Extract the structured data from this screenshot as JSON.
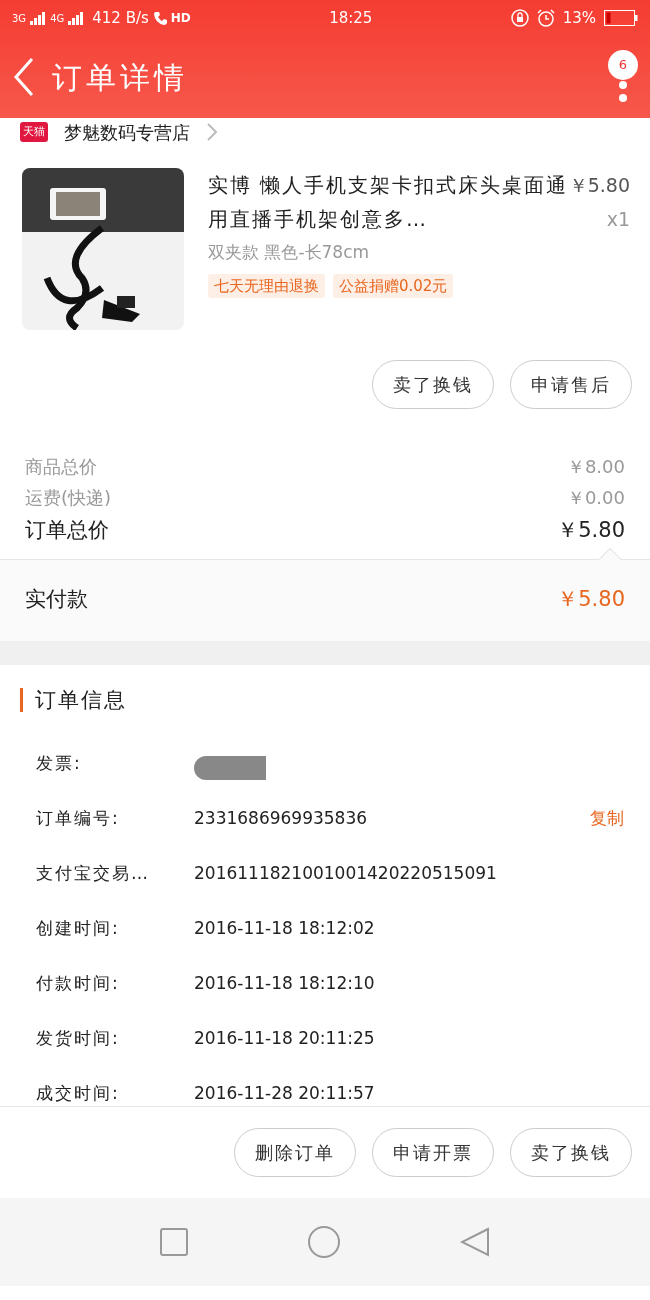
{
  "status_bar": {
    "network_1": "3G",
    "network_2": "4G",
    "speed": "412 B/s",
    "call": "HD",
    "time": "18:25",
    "battery": "13%"
  },
  "header": {
    "title": "订单详情",
    "badge": "6"
  },
  "store": {
    "logo": "天猫",
    "name": "梦魅数码专营店"
  },
  "product": {
    "kind": "picture",
    "title": "实博 懒人手机支架卡扣式床头桌面通用直播手机架创意多…",
    "price": "￥5.80",
    "quantity": "x1",
    "sku": "双夹款 黑色-长78cm",
    "tags": [
      "七天无理由退换",
      "公益捐赠0.02元"
    ],
    "buttons": [
      "卖了换钱",
      "申请售后"
    ]
  },
  "totals": [
    {
      "label": "商品总价",
      "value": "￥8.00",
      "kind": "minor"
    },
    {
      "label": "运费(快递)",
      "value": "￥0.00",
      "kind": "minor"
    },
    {
      "label": "订单总价",
      "value": "￥5.80",
      "kind": "major"
    }
  ],
  "paid": {
    "label": "实付款",
    "value": "￥5.80"
  },
  "order_info": {
    "title": "订单信息",
    "rows": [
      {
        "label": "发票:",
        "kind": "redacted"
      },
      {
        "label": "订单编号:",
        "value": "2331686969935836",
        "action": "复制"
      },
      {
        "label": "支付宝交易…",
        "value": "2016111821001001420220515091"
      },
      {
        "label": "创建时间:",
        "value": "2016-11-18 18:12:02"
      },
      {
        "label": "付款时间:",
        "value": "2016-11-18 18:12:10"
      },
      {
        "label": "发货时间:",
        "value": "2016-11-18 20:11:25"
      },
      {
        "label": "成交时间:",
        "value": "2016-11-28 20:11:57"
      }
    ]
  },
  "bottom_buttons": [
    "删除订单",
    "申请开票",
    "卖了换钱"
  ]
}
